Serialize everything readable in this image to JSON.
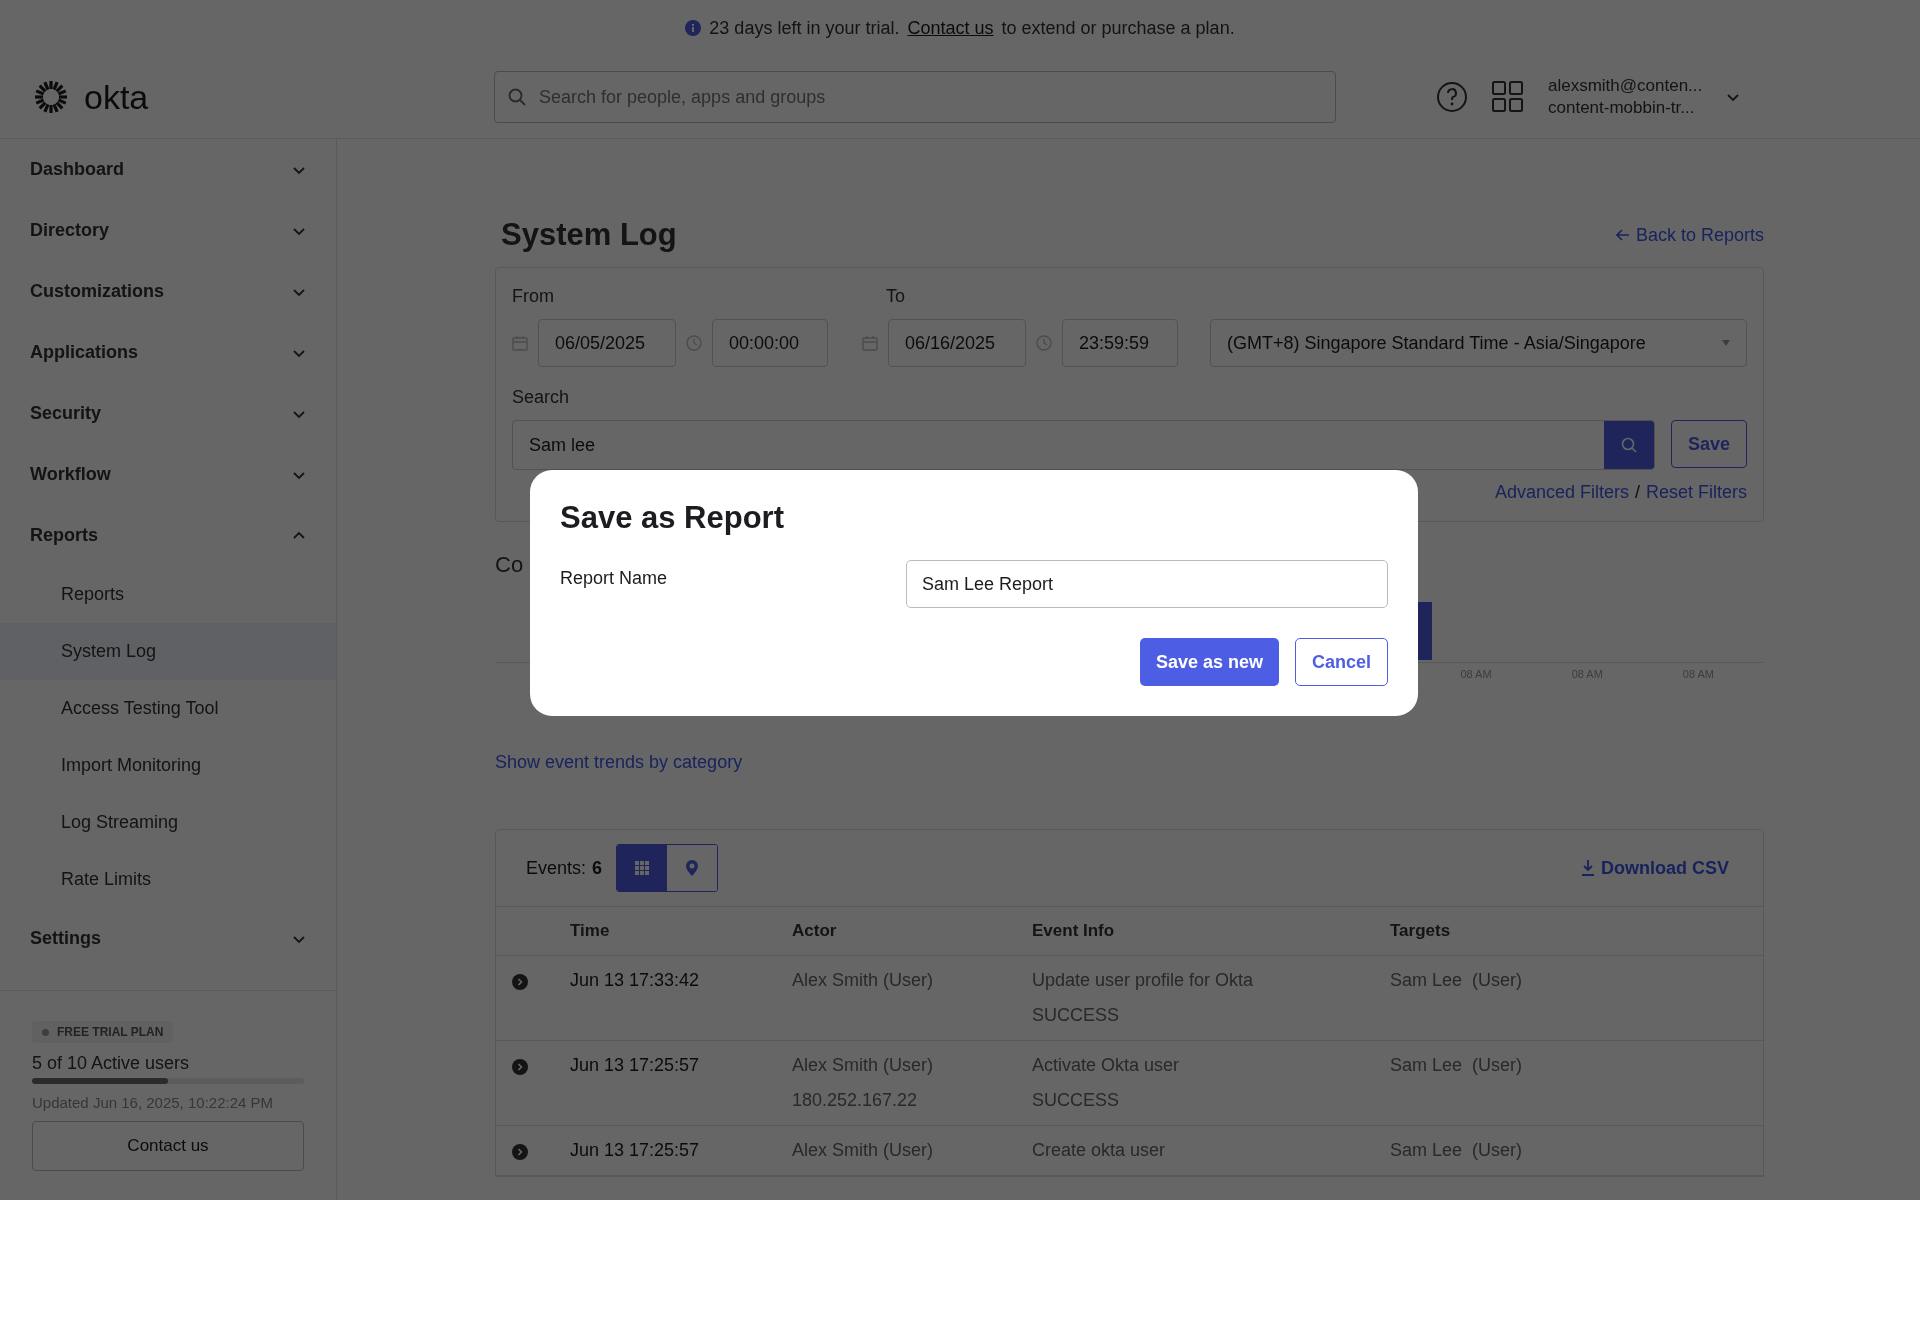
{
  "trial_banner": {
    "text": "23 days left in your trial.",
    "link": "Contact us",
    "suffix": "to extend or purchase a plan."
  },
  "header": {
    "logo": "okta",
    "search": {
      "placeholder": "Search for people, apps and groups"
    },
    "user": {
      "email": "alexsmith@conten...",
      "org": "content-mobbin-tr..."
    }
  },
  "sidebar": {
    "items": [
      {
        "label": "Dashboard",
        "expanded": false
      },
      {
        "label": "Directory",
        "expanded": false
      },
      {
        "label": "Customizations",
        "expanded": false
      },
      {
        "label": "Applications",
        "expanded": false
      },
      {
        "label": "Security",
        "expanded": false
      },
      {
        "label": "Workflow",
        "expanded": false
      },
      {
        "label": "Reports",
        "expanded": true,
        "children": [
          {
            "label": "Reports",
            "selected": false
          },
          {
            "label": "System Log",
            "selected": true
          },
          {
            "label": "Access Testing Tool",
            "selected": false
          },
          {
            "label": "Import Monitoring",
            "selected": false
          },
          {
            "label": "Log Streaming",
            "selected": false
          },
          {
            "label": "Rate Limits",
            "selected": false
          }
        ]
      },
      {
        "label": "Settings",
        "expanded": false
      }
    ],
    "plan": {
      "badge": "FREE TRIAL PLAN",
      "users": "5 of 10 Active users",
      "level": 0.5,
      "updated": "Updated Jun 16, 2025, 10:22:24 PM",
      "button": "Contact us"
    }
  },
  "page": {
    "title": "System Log",
    "back_link": "Back to Reports"
  },
  "filters": {
    "from_label": "From",
    "from_date": "06/05/2025",
    "from_time": "00:00:00",
    "to_label": "To",
    "to_date": "06/16/2025",
    "to_time": "23:59:59",
    "timezone": "(GMT+8) Singapore Standard Time - Asia/Singapore",
    "search_label": "Search",
    "search_value": "Sam lee",
    "save": "Save",
    "advanced": "Advanced Filters",
    "separator": "/",
    "reset": "Reset Filters"
  },
  "chart_section": {
    "heading": "Co",
    "tick_labels": [
      "08 AM",
      "08 AM",
      "08 AM"
    ]
  },
  "trends_link": "Show event trends by category",
  "events": {
    "count_label": "Events:",
    "count": "6",
    "views": [
      {
        "kind": "grid",
        "selected": true
      },
      {
        "kind": "pin",
        "selected": false
      }
    ],
    "download": "Download CSV",
    "columns": [
      "Time",
      "Actor",
      "Event Info",
      "Targets"
    ],
    "rows": [
      {
        "time": "Jun 13 17:33:42",
        "actor": "Alex Smith (User)",
        "actor_ip": "",
        "event": "Update user profile for Okta",
        "result": "SUCCESS",
        "target": "Sam Lee  (User)"
      },
      {
        "time": "Jun 13 17:25:57",
        "actor": "Alex Smith (User)",
        "actor_ip": "180.252.167.22",
        "event": "Activate Okta user",
        "result": "SUCCESS",
        "target": "Sam Lee  (User)"
      },
      {
        "time": "Jun 13 17:25:57",
        "actor": "Alex Smith (User)",
        "event": "Create okta user",
        "target": "Sam Lee  (User)"
      }
    ]
  },
  "modal": {
    "title": "Save as Report",
    "field_label": "Report Name",
    "field_value": "Sam Lee Report",
    "primary": "Save as new",
    "secondary": "Cancel"
  }
}
